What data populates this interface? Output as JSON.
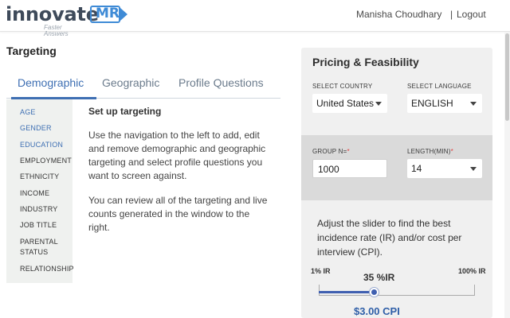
{
  "header": {
    "logo_text": "innovate",
    "logo_badge": "MR",
    "logo_tagline": "Faster Answers",
    "user_name": "Manisha Choudhary",
    "separator": "|",
    "logout_label": "Logout"
  },
  "targeting": {
    "title": "Targeting",
    "tabs": [
      {
        "label": "Demographic",
        "active": true
      },
      {
        "label": "Geographic",
        "active": false
      },
      {
        "label": "Profile Questions",
        "active": false
      }
    ],
    "categories": [
      {
        "label": "AGE",
        "link": true
      },
      {
        "label": "GENDER",
        "link": true
      },
      {
        "label": "EDUCATION",
        "link": true
      },
      {
        "label": "EMPLOYMENT",
        "link": false
      },
      {
        "label": "ETHNICITY",
        "link": false
      },
      {
        "label": "INCOME",
        "link": false
      },
      {
        "label": "INDUSTRY",
        "link": false
      },
      {
        "label": "JOB TITLE",
        "link": false
      },
      {
        "label": "PARENTAL",
        "link": false
      },
      {
        "label": "STATUS",
        "link": false
      },
      {
        "label": "RELATIONSHIP",
        "link": false
      }
    ],
    "setup_title": "Set up targeting",
    "setup_text_1": "Use the navigation to the left to add, edit and remove demographic and geographic targeting and select profile questions you want to screen against.",
    "setup_text_2": "You can review all of the targeting and live counts generated in the window to the right."
  },
  "pricing": {
    "title": "Pricing & Feasibility",
    "country_label": "SELECT COUNTRY",
    "country_value": "United States",
    "language_label": "SELECT LANGUAGE",
    "language_value": "ENGLISH",
    "group_label": "GROUP N=",
    "group_value": "1000",
    "length_label": "LENGTH(MIN)",
    "length_value": "14",
    "required_mark": "*",
    "slider_text": "Adjust the slider to find the best incidence rate (IR) and/or cost per interview (CPI).",
    "ir_min": "1% IR",
    "ir_max": "100% IR",
    "ir_current": "35 %IR",
    "ir_level_percent": 35,
    "cpi": "$3.00 CPI"
  },
  "colors": {
    "accent": "#3e6fb3",
    "logo_blue": "#3f8bd6",
    "required": "#e03b3b"
  }
}
